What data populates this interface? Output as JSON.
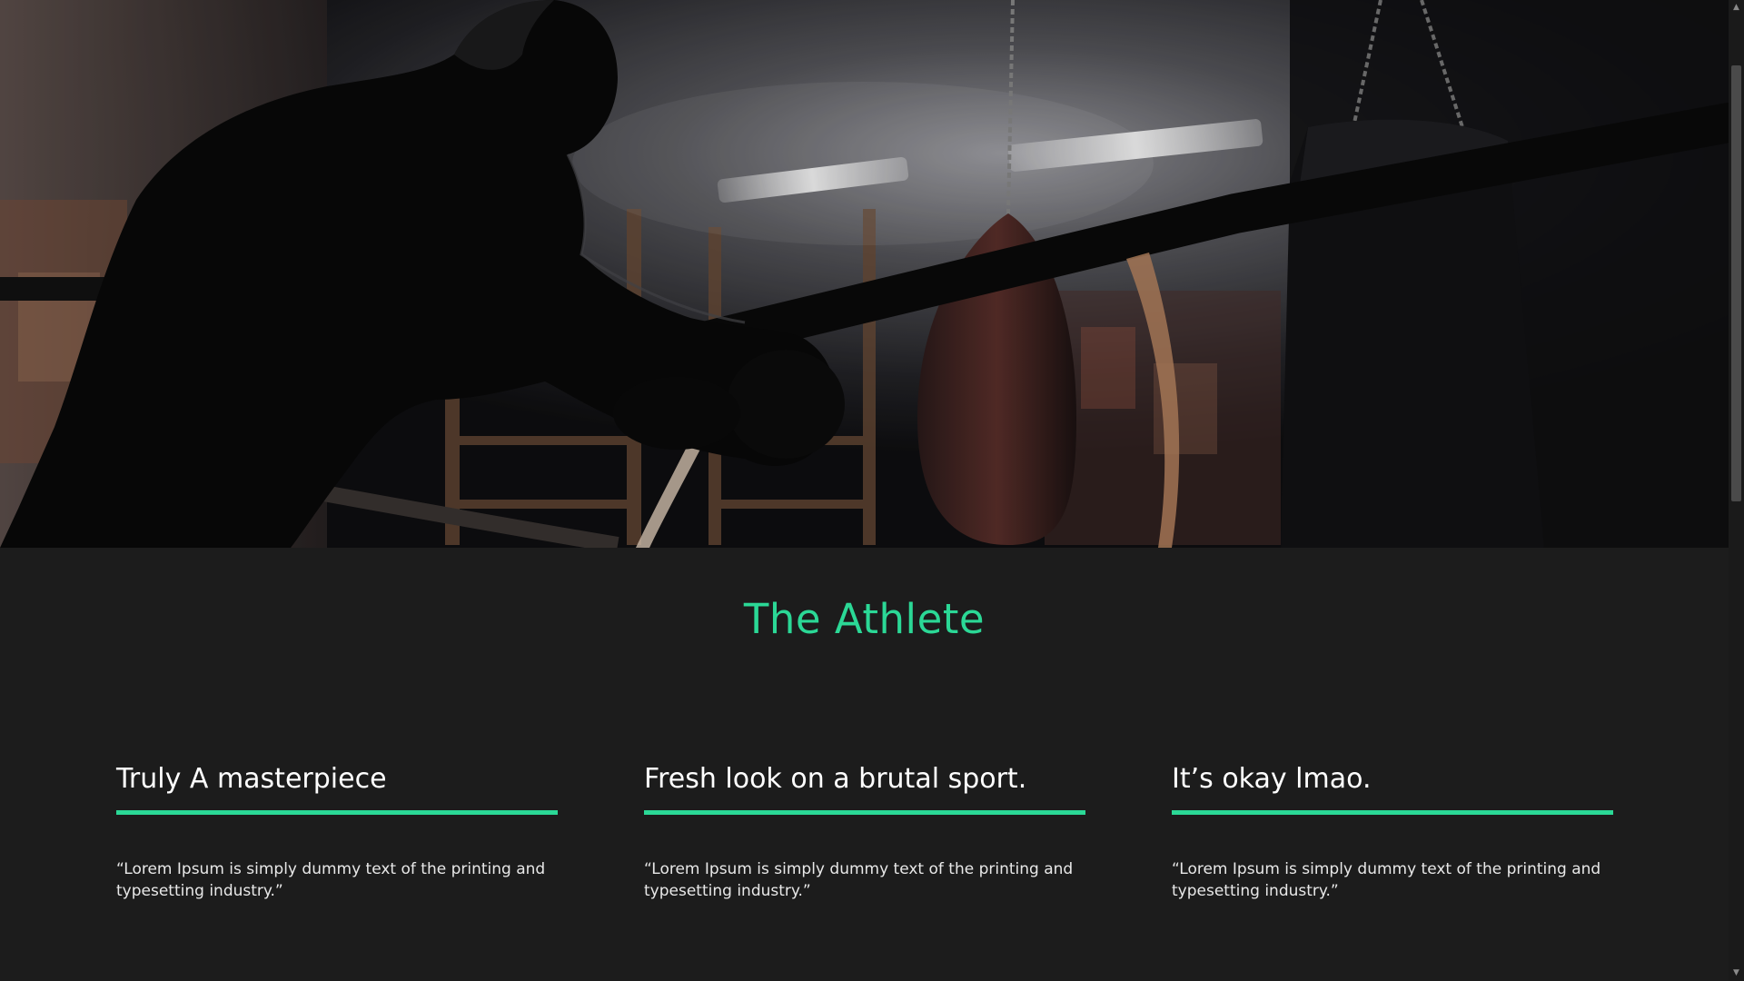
{
  "hero": {
    "image": "boxer-leaning-on-ring-ropes"
  },
  "section": {
    "title": "The Athlete"
  },
  "reviews": [
    {
      "title": "Truly A masterpiece",
      "quote": "“Lorem Ipsum is simply dummy text of the printing and typesetting industry.”"
    },
    {
      "title": "Fresh look on a brutal sport.",
      "quote": "“Lorem Ipsum is simply dummy text of the printing and typesetting industry.”"
    },
    {
      "title": "It’s okay lmao.",
      "quote": "“Lorem Ipsum is simply dummy text of the printing and typesetting industry.”"
    }
  ],
  "colors": {
    "accent": "#2bd896",
    "background": "#1c1c1c",
    "text": "#ffffff"
  },
  "scrollbar": {
    "up_icon": "chevron-up-icon",
    "down_icon": "chevron-down-icon"
  }
}
